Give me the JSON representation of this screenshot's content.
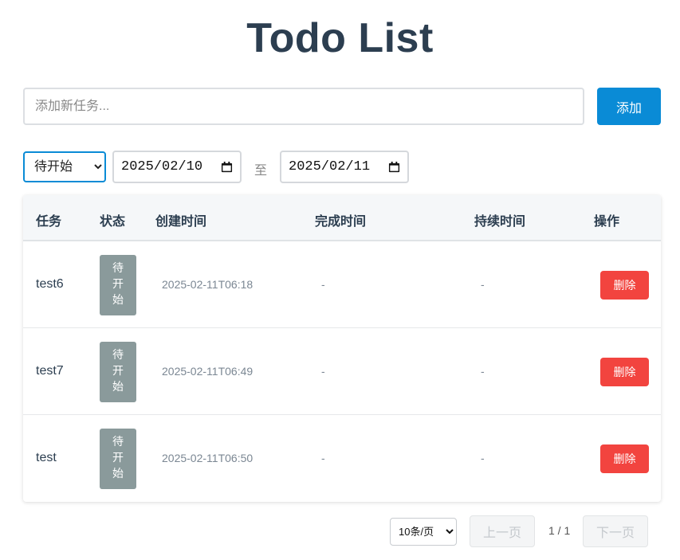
{
  "header": {
    "title": "Todo List"
  },
  "new_task": {
    "placeholder": "添加新任务...",
    "value": "",
    "add_label": "添加"
  },
  "filters": {
    "status_selected": "待开始",
    "status_options": [
      "待开始"
    ],
    "date_from": "2025/02/10",
    "separator": "至",
    "date_to": "2025/02/11"
  },
  "table": {
    "columns": [
      "任务",
      "状态",
      "创建时间",
      "完成时间",
      "持续时间",
      "操作"
    ],
    "rows": [
      {
        "task": "test6",
        "status": [
          "待",
          "开",
          "始"
        ],
        "created": "2025-02-11T06:18",
        "completed": "-",
        "duration": "-",
        "action": "删除"
      },
      {
        "task": "test7",
        "status": [
          "待",
          "开",
          "始"
        ],
        "created": "2025-02-11T06:49",
        "completed": "-",
        "duration": "-",
        "action": "删除"
      },
      {
        "task": "test",
        "status": [
          "待",
          "开",
          "始"
        ],
        "created": "2025-02-11T06:50",
        "completed": "-",
        "duration": "-",
        "action": "删除"
      }
    ]
  },
  "pagination": {
    "page_size": "10条/页",
    "prev_label": "上一页",
    "indicator": "1 / 1",
    "next_label": "下一页"
  },
  "colors": {
    "title": "#2c3e50",
    "primary": "#0a8bd6",
    "danger": "#f2443f",
    "badge": "#8a9a9b"
  }
}
